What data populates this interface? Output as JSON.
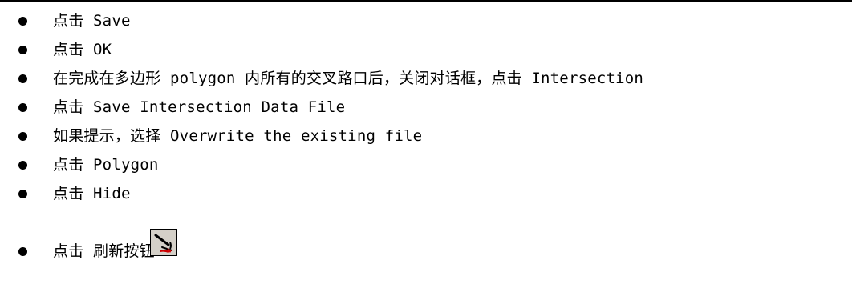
{
  "steps": [
    {
      "text": "点击 Save"
    },
    {
      "text": "点击 OK"
    },
    {
      "text": "在完成在多边形 polygon 内所有的交叉路口后，关闭对话框，点击 Intersection"
    },
    {
      "text": "点击 Save Intersection Data File"
    },
    {
      "text": "如果提示，选择 Overwrite the existing file"
    },
    {
      "text": "点击 Polygon"
    },
    {
      "text": "点击 Hide"
    },
    {
      "text": "点击 刷新按钮",
      "icon": "refresh-button-icon"
    }
  ],
  "colors": {
    "text": "#000000",
    "background": "#ffffff",
    "icon_face": "#d4d0c8",
    "icon_accent": "#cc0000"
  }
}
